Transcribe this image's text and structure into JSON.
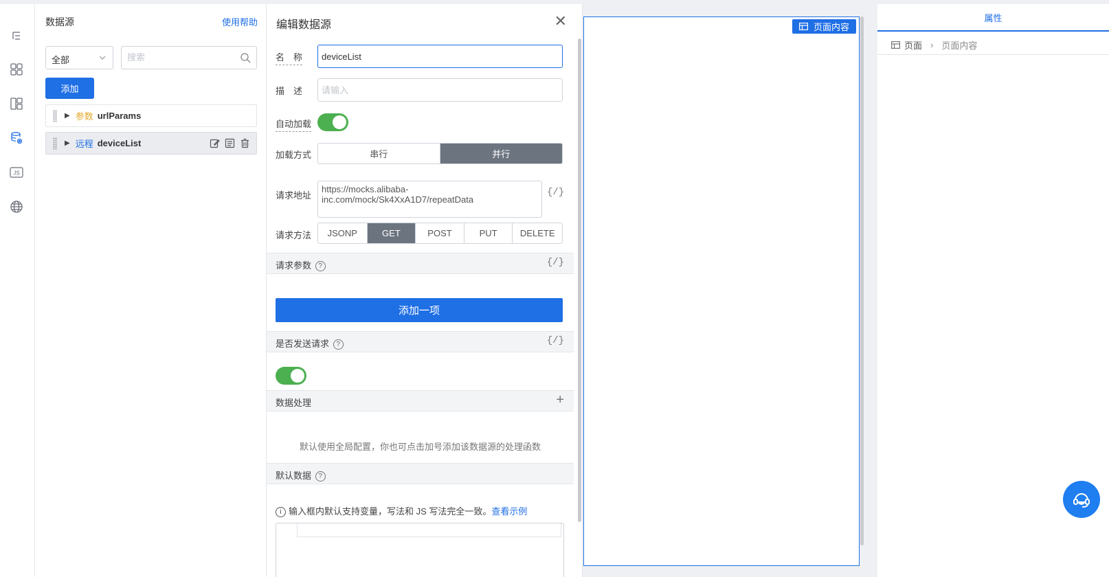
{
  "rail": {
    "icons": [
      "outline-icon",
      "components-icon",
      "layout-icon",
      "datasource-icon",
      "js-icon",
      "globe-icon"
    ],
    "js_label": "JS",
    "active": "datasource-icon",
    "accent": "#1f6fe5"
  },
  "datasource_panel": {
    "title": "数据源",
    "help_link": "使用帮助",
    "filter_value": "全部",
    "search_placeholder": "搜索",
    "add_label": "添加",
    "items": [
      {
        "type_label": "参数",
        "name": "urlParams",
        "type_color": "#e3a82b",
        "selected": false
      },
      {
        "type_label": "远程",
        "name": "deviceList",
        "type_color": "#1f6fe5",
        "selected": true
      }
    ]
  },
  "edit_panel": {
    "title": "编辑数据源",
    "name_label": "名　称",
    "name_value": "deviceList",
    "desc_label": "描　述",
    "desc_placeholder": "请输入",
    "autoload_label": "自动加载",
    "autoload_on": true,
    "load_mode_label": "加载方式",
    "load_modes": [
      "串行",
      "并行"
    ],
    "load_mode_selected": "并行",
    "url_label": "请求地址",
    "url_value": "https://mocks.alibaba-inc.com/mock/Sk4XxA1D7/repeatData",
    "method_label": "请求方法",
    "methods": [
      "JSONP",
      "GET",
      "POST",
      "PUT",
      "DELETE"
    ],
    "method_selected": "GET",
    "params_section": "请求参数",
    "add_item_label": "添加一项",
    "send_section": "是否发送请求",
    "send_on": true,
    "process_section": "数据处理",
    "process_hint": "默认使用全局配置，你也可点击加号添加该数据源的处理函数",
    "default_section": "默认数据",
    "default_info": "输入框内默认支持变量，写法和 JS 写法完全一致。",
    "default_info_link": "查看示例",
    "code_toggle": "{/}",
    "toggle_color": "#4caf50"
  },
  "canvas": {
    "tag_label": "页面内容"
  },
  "props_panel": {
    "tab_label": "属性",
    "breadcrumb": [
      "页面",
      "页面内容"
    ]
  }
}
